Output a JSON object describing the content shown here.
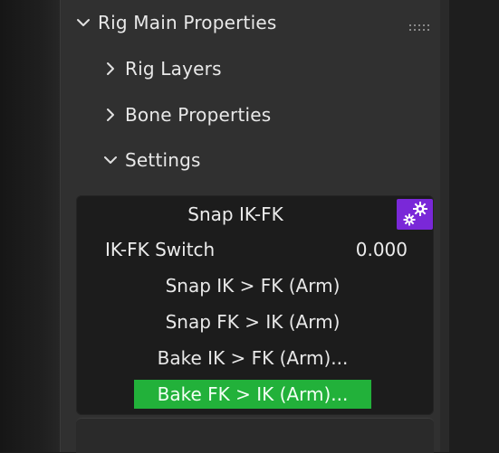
{
  "panel": {
    "header": {
      "label": "Rig Main Properties",
      "expanded": true
    },
    "subpanels": [
      {
        "label": "Rig Layers",
        "expanded": false
      },
      {
        "label": "Bone Properties",
        "expanded": false
      },
      {
        "label": "Settings",
        "expanded": true
      }
    ]
  },
  "snap": {
    "title": "Snap IK-FK",
    "icon": "gears-icon",
    "icon_color": "#7a28d8",
    "switch": {
      "label": "IK-FK Switch",
      "value": "0.000"
    },
    "operators": [
      {
        "label": "Snap IK > FK (Arm)"
      },
      {
        "label": "Snap FK > IK (Arm)"
      },
      {
        "label": "Bake IK > FK (Arm)..."
      },
      {
        "label": "Bake FK > IK (Arm)...",
        "highlight_color": "#22b13a"
      }
    ]
  }
}
